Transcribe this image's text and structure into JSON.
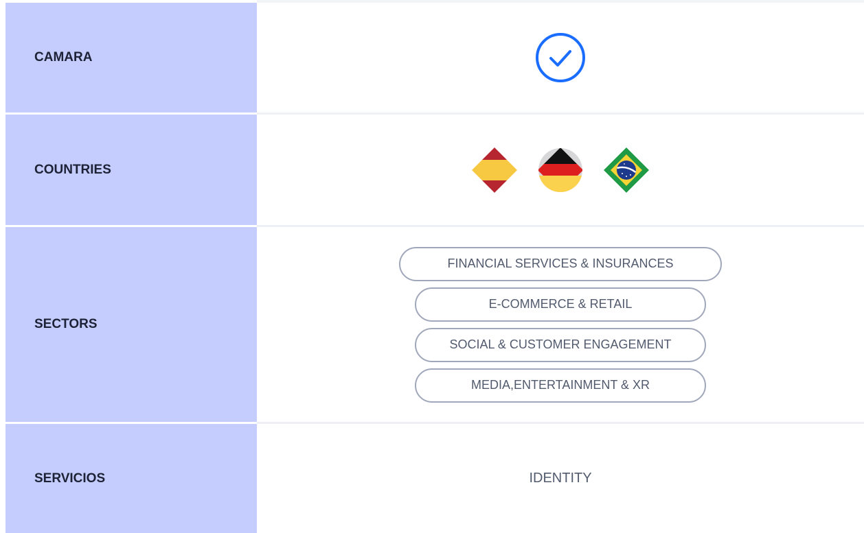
{
  "rows": {
    "camara": {
      "label": "CAMARA",
      "check_icon": "check-circle-icon",
      "accent": "#1a6dff"
    },
    "countries": {
      "label": "COUNTRIES",
      "flags": [
        "spain-flag-icon",
        "germany-flag-icon",
        "brazil-flag-icon"
      ]
    },
    "sectors": {
      "label": "SECTORS",
      "items": [
        "FINANCIAL SERVICES & INSURANCES",
        "E-COMMERCE & RETAIL",
        "SOCIAL & CUSTOMER ENGAGEMENT",
        "MEDIA,ENTERTAINMENT & XR"
      ]
    },
    "servicios": {
      "label": "SERVICIOS",
      "value": "IDENTITY"
    }
  },
  "colors": {
    "label_bg": "#c4cdfd",
    "pill_border": "#a1a7ba",
    "text_muted": "#525a6e"
  }
}
